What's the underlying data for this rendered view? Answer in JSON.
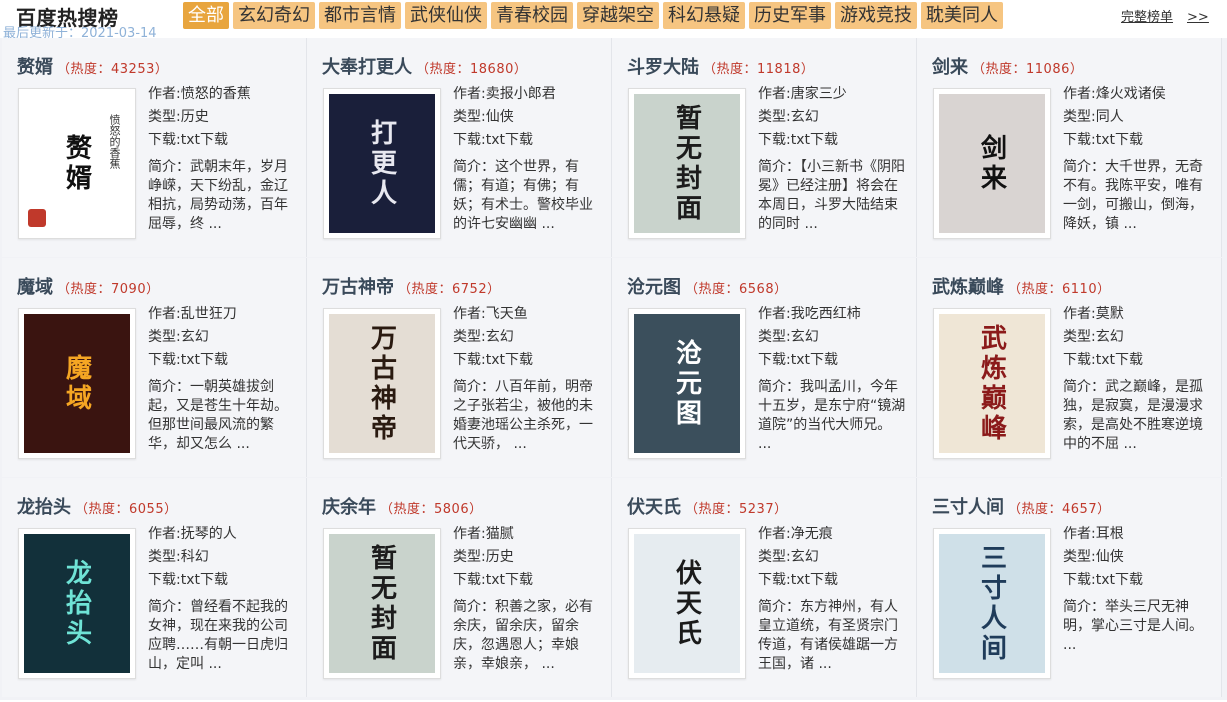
{
  "header": {
    "title": "百度热搜榜",
    "updated": "最后更新于：2021-03-14",
    "full_rank_label": "完整榜单",
    "full_rank_arrows": ">>"
  },
  "tabs": [
    {
      "label": "全部",
      "active": true
    },
    {
      "label": "玄幻奇幻",
      "active": false
    },
    {
      "label": "都市言情",
      "active": false
    },
    {
      "label": "武侠仙侠",
      "active": false
    },
    {
      "label": "青春校园",
      "active": false
    },
    {
      "label": "穿越架空",
      "active": false
    },
    {
      "label": "科幻悬疑",
      "active": false
    },
    {
      "label": "历史军事",
      "active": false
    },
    {
      "label": "游戏竞技",
      "active": false
    },
    {
      "label": "耽美同人",
      "active": false
    }
  ],
  "colors": {
    "tab_bg": "#f6c581",
    "tab_active_bg": "#e8a53e",
    "heat_red": "#c0392b",
    "grid_bg": "#f1f2f6"
  },
  "books": [
    {
      "title": "赘婿",
      "heat": "（热度：43253）",
      "author": "作者:愤怒的香蕉",
      "type": "类型:历史",
      "download": "下载:txt下载",
      "intro": "简介：武朝末年，岁月峥嵘，天下纷乱，金辽相抗，局势动荡，百年屈辱，终 ...",
      "cover_text": "赘婿",
      "cover_bg": "#ffffff",
      "cover_fg": "#111111",
      "cover_side": "愤怒的香蕉"
    },
    {
      "title": "大奉打更人",
      "heat": "（热度：18680）",
      "author": "作者:卖报小郎君",
      "type": "类型:仙侠",
      "download": "下载:txt下载",
      "intro": "简介：这个世界，有儒；有道；有佛；有妖；有术士。警校毕业的许七安幽幽 ...",
      "cover_text": "打更人",
      "cover_bg": "#1a1f3a",
      "cover_fg": "#e8e8f0",
      "cover_side": ""
    },
    {
      "title": "斗罗大陆",
      "heat": "（热度：11818）",
      "author": "作者:唐家三少",
      "type": "类型:玄幻",
      "download": "下载:txt下载",
      "intro": "简介：【小三新书《阴阳冕》已经注册】将会在本周日，斗罗大陆结束的同时 ...",
      "cover_text": "暂无封面",
      "cover_bg": "#c9d3cc",
      "cover_fg": "#1c1c1c",
      "cover_side": ""
    },
    {
      "title": "剑来",
      "heat": "（热度：11086）",
      "author": "作者:烽火戏诸侯",
      "type": "类型:同人",
      "download": "下载:txt下载",
      "intro": "简介：大千世界，无奇不有。我陈平安，唯有一剑，可搬山，倒海，降妖，镇 ...",
      "cover_text": "剑来",
      "cover_bg": "#d9d4d2",
      "cover_fg": "#111111",
      "cover_side": ""
    },
    {
      "title": "魔域",
      "heat": "（热度：7090）",
      "author": "作者:乱世狂刀",
      "type": "类型:玄幻",
      "download": "下载:txt下载",
      "intro": "简介：一朝英雄拔剑起，又是苍生十年劫。但那世间最风流的繁华，却又怎么 ...",
      "cover_text": "魔域",
      "cover_bg": "#3a1410",
      "cover_fg": "#f5a623",
      "cover_side": ""
    },
    {
      "title": "万古神帝",
      "heat": "（热度：6752）",
      "author": "作者:飞天鱼",
      "type": "类型:玄幻",
      "download": "下载:txt下载",
      "intro": "简介：八百年前，明帝之子张若尘，被他的未婚妻池瑶公主杀死，一代天骄， ...",
      "cover_text": "万古神帝",
      "cover_bg": "#e4ddd4",
      "cover_fg": "#2a1a10",
      "cover_side": ""
    },
    {
      "title": "沧元图",
      "heat": "（热度：6568）",
      "author": "作者:我吃西红柿",
      "type": "类型:玄幻",
      "download": "下载:txt下载",
      "intro": "简介：我叫孟川，今年十五岁，是东宁府“镜湖道院”的当代大师兄。 ...",
      "cover_text": "沧元图",
      "cover_bg": "#3b4f5c",
      "cover_fg": "#ffffff",
      "cover_side": ""
    },
    {
      "title": "武炼巅峰",
      "heat": "（热度：6110）",
      "author": "作者:莫默",
      "type": "类型:玄幻",
      "download": "下载:txt下载",
      "intro": "简介：武之巅峰，是孤独，是寂寞，是漫漫求索，是高处不胜寒逆境中的不屈 ...",
      "cover_text": "武炼巅峰",
      "cover_bg": "#efe6d6",
      "cover_fg": "#8b1a1a",
      "cover_side": ""
    },
    {
      "title": "龙抬头",
      "heat": "（热度：6055）",
      "author": "作者:抚琴的人",
      "type": "类型:科幻",
      "download": "下载:txt下载",
      "intro": "简介：曾经看不起我的女神，现在来我的公司应聘……有朝一日虎归山，定叫 ...",
      "cover_text": "龙抬头",
      "cover_bg": "#12303a",
      "cover_fg": "#6fe3d6",
      "cover_side": ""
    },
    {
      "title": "庆余年",
      "heat": "（热度：5806）",
      "author": "作者:猫腻",
      "type": "类型:历史",
      "download": "下载:txt下载",
      "intro": "简介：积善之家，必有余庆，留余庆，留余庆，忽遇恩人；幸娘亲，幸娘亲， ...",
      "cover_text": "暂无封面",
      "cover_bg": "#c9d3cc",
      "cover_fg": "#1c1c1c",
      "cover_side": ""
    },
    {
      "title": "伏天氏",
      "heat": "（热度：5237）",
      "author": "作者:净无痕",
      "type": "类型:玄幻",
      "download": "下载:txt下载",
      "intro": "简介：东方神州，有人皇立道统，有圣贤宗门传道，有诸侯雄踞一方王国，诸 ...",
      "cover_text": "伏天氏",
      "cover_bg": "#e6ecf0",
      "cover_fg": "#1a1a1a",
      "cover_side": ""
    },
    {
      "title": "三寸人间",
      "heat": "（热度：4657）",
      "author": "作者:耳根",
      "type": "类型:仙侠",
      "download": "下载:txt下载",
      "intro": "简介：举头三尺无神明，掌心三寸是人间。 ...",
      "cover_text": "三寸人间",
      "cover_bg": "#cfe0e8",
      "cover_fg": "#1f3c5a",
      "cover_side": ""
    }
  ]
}
